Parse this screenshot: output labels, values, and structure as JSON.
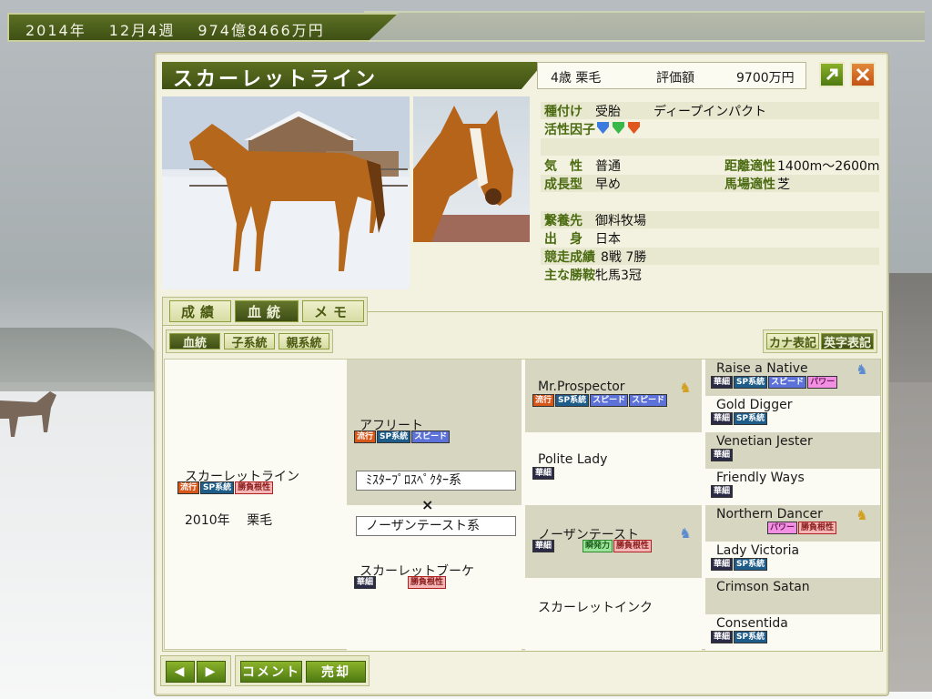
{
  "topbar": {
    "text": "2014年　 12月4週　 974億8466万円"
  },
  "horse": {
    "name": "スカーレットライン",
    "age_color": "4歳 栗毛",
    "value_label": "評価額",
    "value": "9700万円"
  },
  "profile": {
    "breeding_label": "種付け",
    "breeding_status": "受胎",
    "breeding_sire": "ディープインパクト",
    "factor_label": "活性因子",
    "temper_label": "気　性",
    "temper_value": "普通",
    "distance_label": "距離適性",
    "distance_value": "1400m～2600m",
    "growth_label": "成長型",
    "growth_value": "早め",
    "track_label": "馬場適性",
    "track_value": "芝",
    "farm_label": "繋養先",
    "farm_value": "御料牧場",
    "origin_label": "出　身",
    "origin_value": "日本",
    "record_label": "競走成績",
    "record_value": "8戦 7勝",
    "wins_label": "主な勝鞍",
    "wins_value": "牝馬3冠"
  },
  "tabs": {
    "seiseki": "成績",
    "kettou": "血統",
    "memo": "メモ"
  },
  "subtabs": {
    "kettou": "血統",
    "child": "子系統",
    "parent": "親系統"
  },
  "notation": {
    "kana": "カナ表記",
    "eiji": "英字表記"
  },
  "pedigree": {
    "self_name": "スカーレットライン",
    "self_year_color": "2010年　 栗毛",
    "sire": "アフリート",
    "dam": "スカーレットブーケ",
    "sire_line": "ﾐｽﾀｰﾌﾟﾛｽﾍﾟｸﾀｰ系",
    "dam_line": "ノーザンテースト系",
    "cross": "×",
    "ss": "Mr.Prospector",
    "sd": "Polite Lady",
    "ds": "ノーザンテースト",
    "dd": "スカーレットインク",
    "sss": "Raise a Native",
    "ssd": "Gold Digger",
    "sds": "Venetian Jester",
    "sdd": "Friendly Ways",
    "dss": "Northern Dancer",
    "dsd": "Lady Victoria",
    "dds": "Crimson Satan",
    "ddd": "Consentida"
  },
  "badges": {
    "ryuko": "流行",
    "sp": "SP系統",
    "speed": "スピード",
    "power": "パワー",
    "konjo": "勝負根性",
    "keisai": "華細",
    "shunpatsu": "瞬発力"
  },
  "buttons": {
    "prev": "◀",
    "next": "▶",
    "comment": "コメント",
    "sell": "売却"
  },
  "colors": {
    "accent_green": "#4f6a18",
    "panel": "#f3f2e1",
    "cell_shaded": "#d7d6c1"
  }
}
